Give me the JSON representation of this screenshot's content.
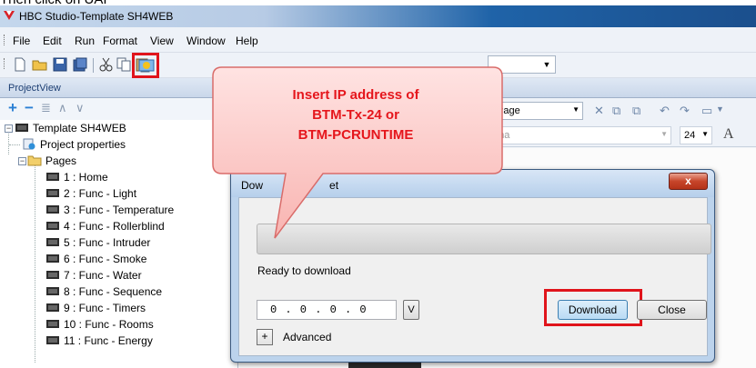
{
  "caption": "Then click on UAI",
  "window": {
    "title": "HBC Studio-Template SH4WEB"
  },
  "menu": [
    "File",
    "Edit",
    "Run",
    "Format",
    "View",
    "Window",
    "Help"
  ],
  "project_view": {
    "header": "ProjectView",
    "root": "Template SH4WEB",
    "project_properties": "Project properties",
    "pages_folder": "Pages",
    "pages": [
      "1 : Home",
      "2 : Func - Light",
      "3 : Func - Temperature",
      "4 : Func - Rollerblind",
      "5 : Func - Intruder",
      "6 : Func - Smoke",
      "7 : Func - Water",
      "8 : Func - Sequence",
      "9 : Func - Timers",
      "10 : Func - Rooms",
      "11 : Func - Energy"
    ]
  },
  "editor": {
    "page_combo": "Page",
    "font_combo": "oma",
    "font_size": "24"
  },
  "dialog": {
    "title": "Download to target",
    "title_visible_start": "Dow",
    "title_visible_end": "et",
    "close_symbol": "x",
    "status": "Ready to download",
    "ip_value": "0 . 0 . 0 . 0",
    "ip_button": "V",
    "download_button": "Download",
    "close_button": "Close",
    "advanced_toggle": "+",
    "advanced_label": "Advanced"
  },
  "callout": {
    "lines": [
      "Insert IP address of",
      "BTM-Tx-24 or",
      "BTM-PCRUNTIME"
    ],
    "color": "#e5161c"
  },
  "highlight_color": "#e0141b"
}
